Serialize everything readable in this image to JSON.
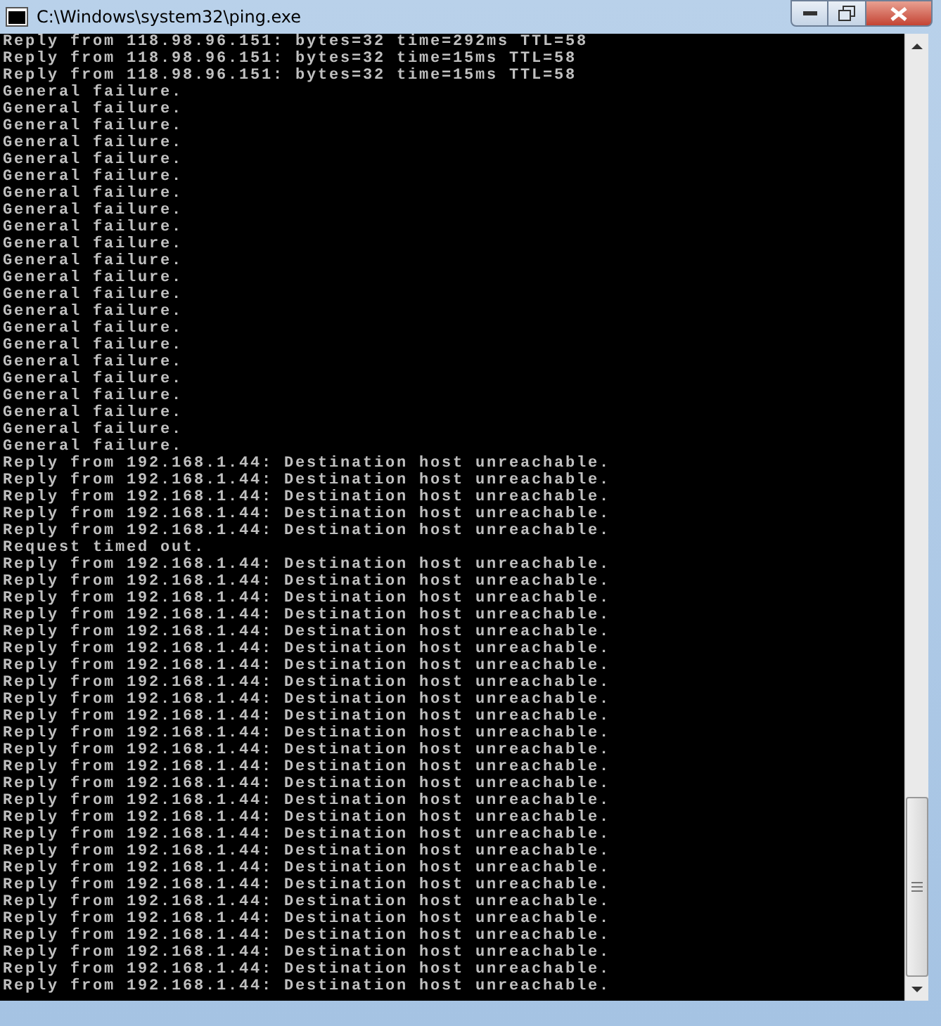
{
  "window": {
    "title": "C:\\Windows\\system32\\ping.exe"
  },
  "console_lines": [
    "Reply from 118.98.96.151: bytes=32 time=292ms TTL=58",
    "Reply from 118.98.96.151: bytes=32 time=15ms TTL=58",
    "Reply from 118.98.96.151: bytes=32 time=15ms TTL=58",
    "General failure.",
    "General failure.",
    "General failure.",
    "General failure.",
    "General failure.",
    "General failure.",
    "General failure.",
    "General failure.",
    "General failure.",
    "General failure.",
    "General failure.",
    "General failure.",
    "General failure.",
    "General failure.",
    "General failure.",
    "General failure.",
    "General failure.",
    "General failure.",
    "General failure.",
    "General failure.",
    "General failure.",
    "General failure.",
    "Reply from 192.168.1.44: Destination host unreachable.",
    "Reply from 192.168.1.44: Destination host unreachable.",
    "Reply from 192.168.1.44: Destination host unreachable.",
    "Reply from 192.168.1.44: Destination host unreachable.",
    "Reply from 192.168.1.44: Destination host unreachable.",
    "Request timed out.",
    "Reply from 192.168.1.44: Destination host unreachable.",
    "Reply from 192.168.1.44: Destination host unreachable.",
    "Reply from 192.168.1.44: Destination host unreachable.",
    "Reply from 192.168.1.44: Destination host unreachable.",
    "Reply from 192.168.1.44: Destination host unreachable.",
    "Reply from 192.168.1.44: Destination host unreachable.",
    "Reply from 192.168.1.44: Destination host unreachable.",
    "Reply from 192.168.1.44: Destination host unreachable.",
    "Reply from 192.168.1.44: Destination host unreachable.",
    "Reply from 192.168.1.44: Destination host unreachable.",
    "Reply from 192.168.1.44: Destination host unreachable.",
    "Reply from 192.168.1.44: Destination host unreachable.",
    "Reply from 192.168.1.44: Destination host unreachable.",
    "Reply from 192.168.1.44: Destination host unreachable.",
    "Reply from 192.168.1.44: Destination host unreachable.",
    "Reply from 192.168.1.44: Destination host unreachable.",
    "Reply from 192.168.1.44: Destination host unreachable.",
    "Reply from 192.168.1.44: Destination host unreachable.",
    "Reply from 192.168.1.44: Destination host unreachable.",
    "Reply from 192.168.1.44: Destination host unreachable.",
    "Reply from 192.168.1.44: Destination host unreachable.",
    "Reply from 192.168.1.44: Destination host unreachable.",
    "Reply from 192.168.1.44: Destination host unreachable.",
    "Reply from 192.168.1.44: Destination host unreachable.",
    "Reply from 192.168.1.44: Destination host unreachable.",
    "Reply from 192.168.1.44: Destination host unreachable."
  ]
}
